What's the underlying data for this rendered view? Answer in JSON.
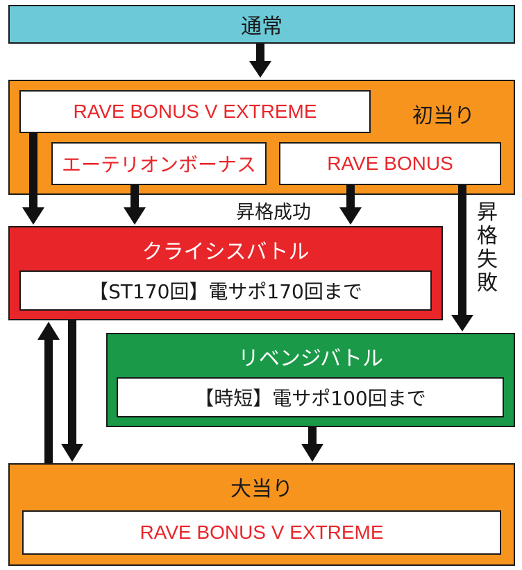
{
  "nodes": {
    "normal": {
      "label": "通常",
      "color": "#6ccad8"
    },
    "first_hit": {
      "label": "初当り",
      "color": "#f7941d",
      "extreme": "RAVE BONUS V EXTREME",
      "aetherion": "エーテリオンボーナス",
      "rave": "RAVE BONUS"
    },
    "crisis_battle": {
      "label": "クライシスバトル",
      "color": "#e8262a",
      "detail": "【ST170回】電サポ170回まで"
    },
    "revenge_battle": {
      "label": "リベンジバトル",
      "color": "#1a9a48",
      "detail": "【時短】電サポ100回まで"
    },
    "big_hit": {
      "label": "大当り",
      "color": "#f7941d",
      "extreme": "RAVE BONUS V EXTREME"
    }
  },
  "edges": {
    "upgrade_success": "昇格成功",
    "upgrade_fail": [
      "昇",
      "格",
      "失",
      "敗"
    ]
  }
}
